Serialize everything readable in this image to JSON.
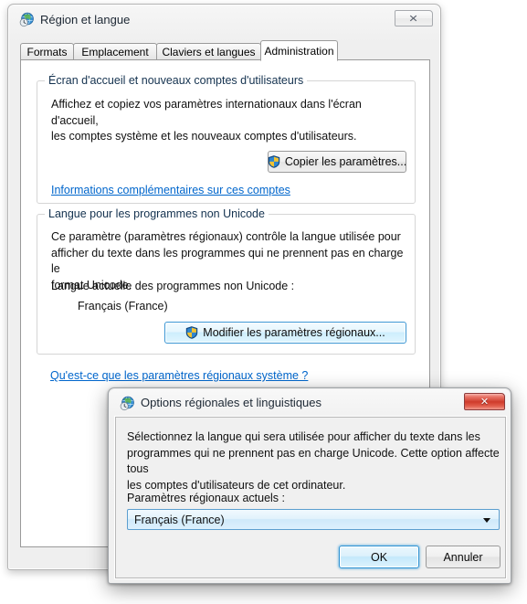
{
  "main_window": {
    "title": "Région et langue",
    "icon": "globe-clock-icon",
    "close_label": "✕",
    "tabs": [
      {
        "label": "Formats",
        "active": false
      },
      {
        "label": "Emplacement",
        "active": false
      },
      {
        "label": "Claviers et langues",
        "active": false
      },
      {
        "label": "Administration",
        "active": true
      }
    ],
    "group_welcome": {
      "legend": "Écran d'accueil et nouveaux comptes d'utilisateurs",
      "description_line1": "Affichez et copiez vos paramètres internationaux dans l'écran d'accueil,",
      "description_line2": "les comptes système et les nouveaux comptes d'utilisateurs.",
      "copy_button": "Copier les paramètres...",
      "link": "Informations complémentaires sur ces comptes"
    },
    "group_nonunicode": {
      "legend": "Langue pour les programmes non Unicode",
      "description_line1": "Ce paramètre (paramètres régionaux) contrôle la langue utilisée pour",
      "description_line2": "afficher du texte dans les programmes qui ne prennent pas en charge le",
      "description_line3": "format Unicode.",
      "current_label": "Langue actuelle des programmes non Unicode :",
      "current_value": "Français (France)",
      "change_button": "Modifier les paramètres régionaux...",
      "link": "Qu'est-ce que les paramètres régionaux système ?"
    }
  },
  "modal": {
    "title": "Options régionales et linguistiques",
    "icon": "globe-clock-icon",
    "close_label": "✕",
    "description_line1": "Sélectionnez la langue qui sera utilisée pour afficher du texte dans les",
    "description_line2": "programmes qui ne prennent pas en charge Unicode. Cette option affecte tous",
    "description_line3": "les comptes d'utilisateurs de cet ordinateur.",
    "combo_label": "Paramètres régionaux actuels :",
    "combo_value": "Français (France)",
    "ok_button": "OK",
    "cancel_button": "Annuler"
  },
  "colors": {
    "link": "#0066CC",
    "legend_text": "#14324F",
    "focus_blue": "#3C97D4",
    "close_red": "#CF3B2B",
    "window_chrome": "#F0F0F0"
  }
}
